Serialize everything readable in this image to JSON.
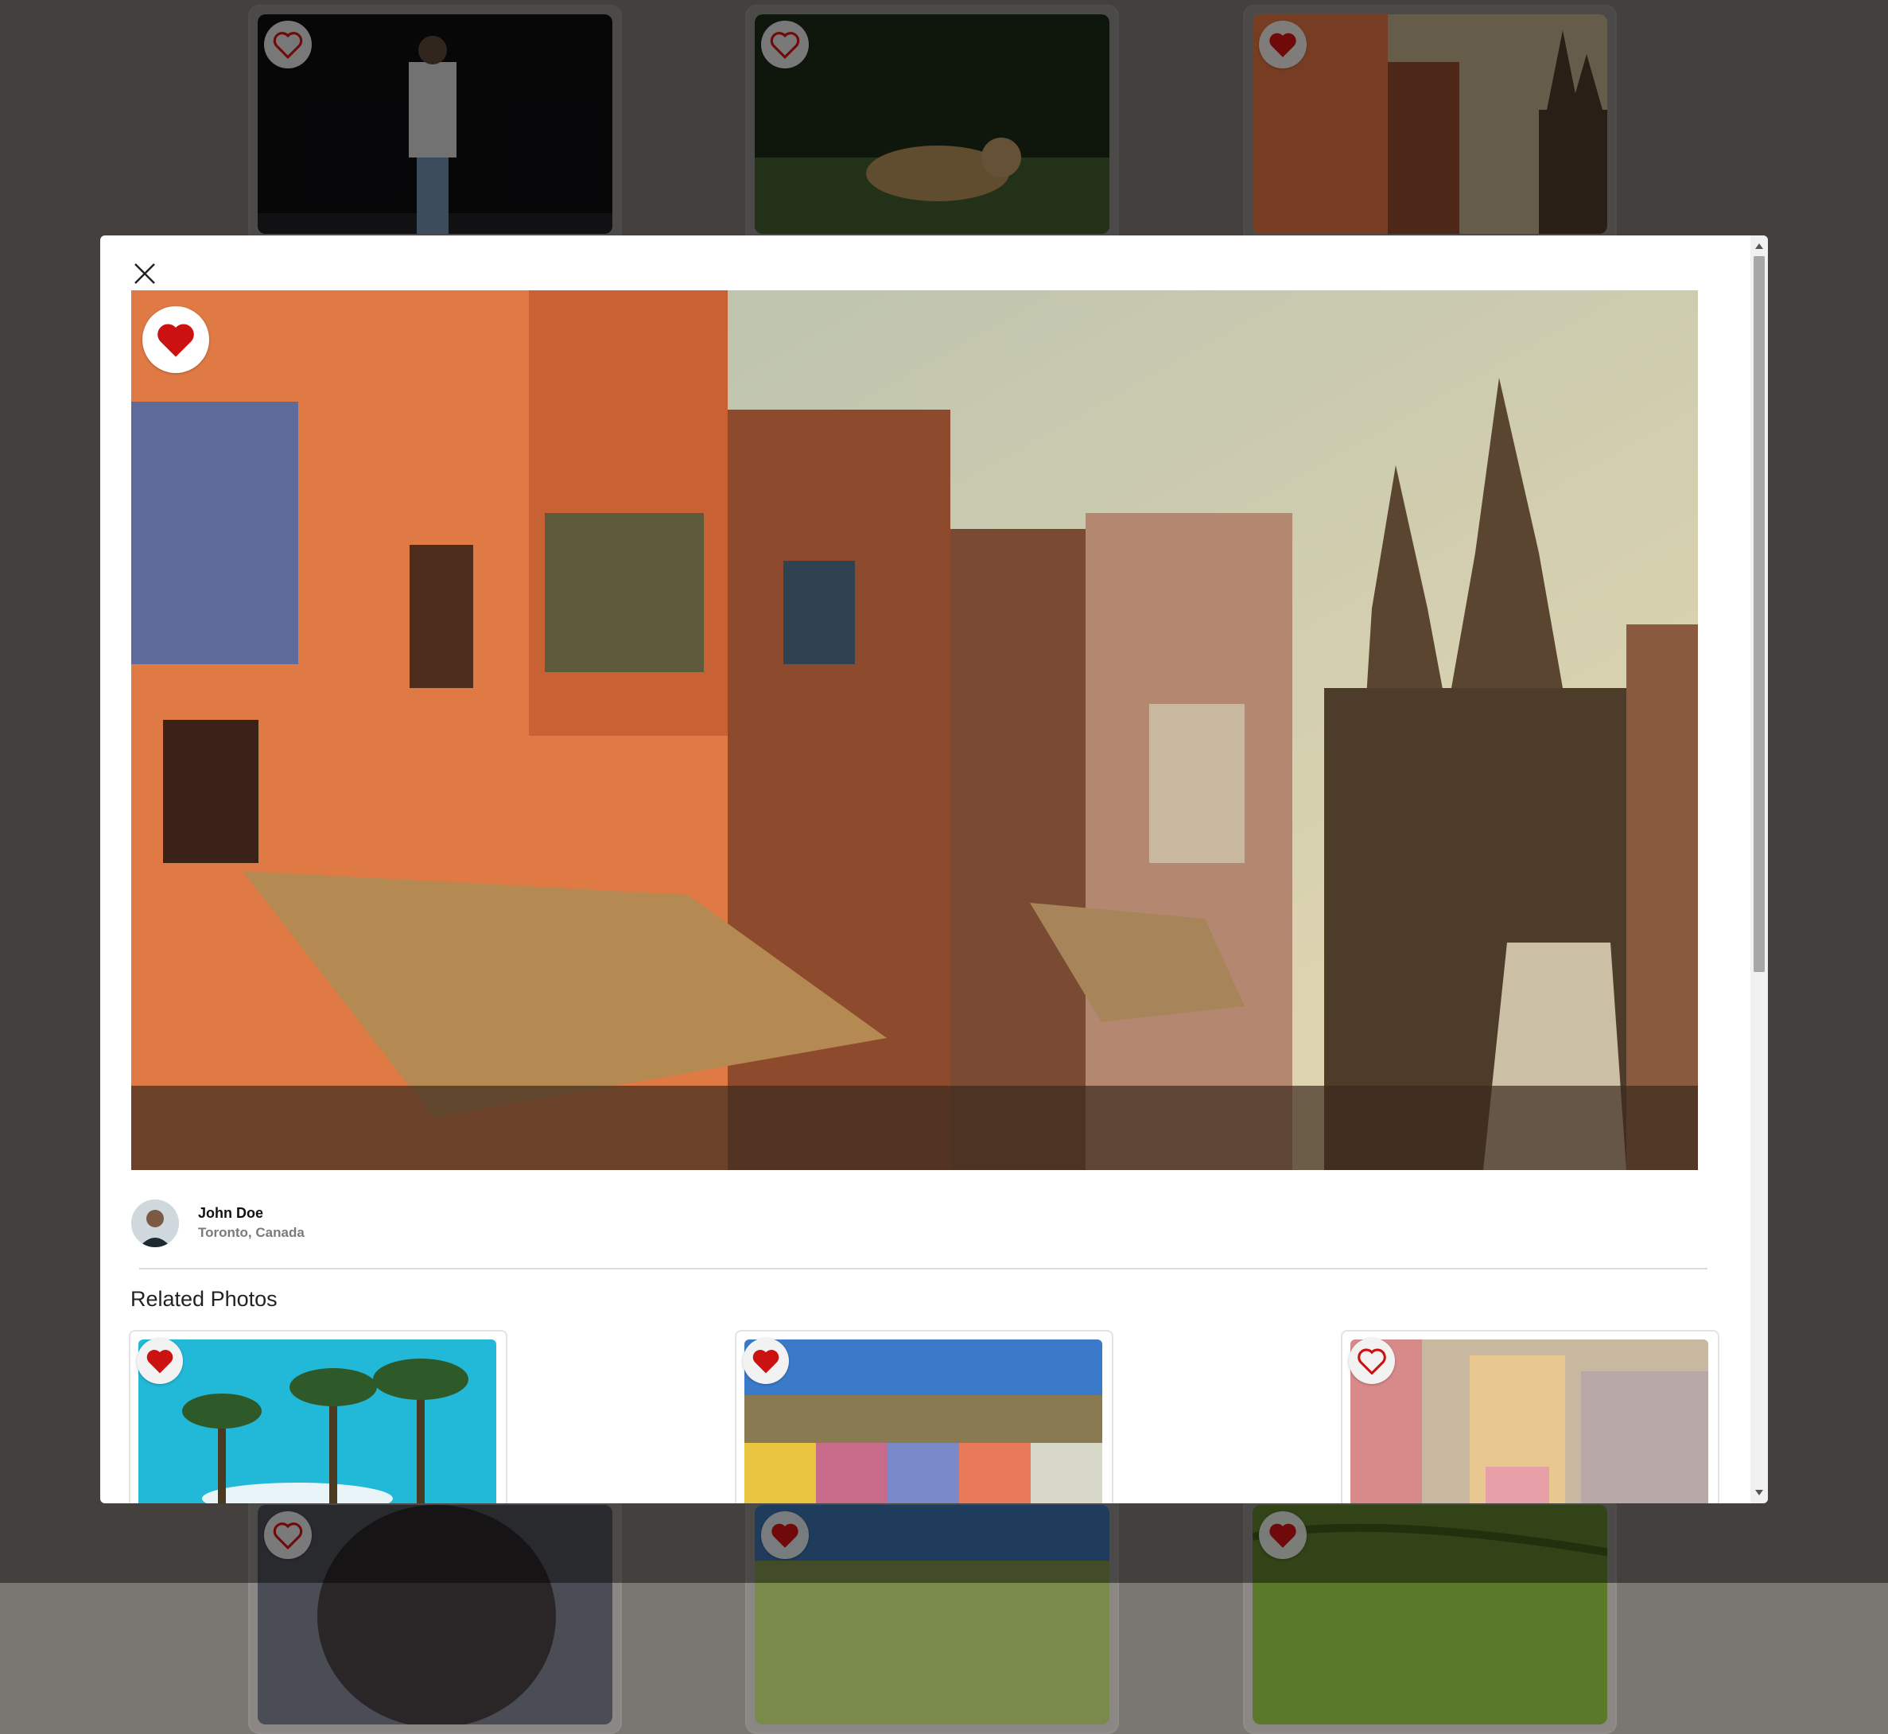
{
  "gallery": {
    "cards": [
      {
        "photo": "man-night-street",
        "favorited": false
      },
      {
        "photo": "jaguar-jungle",
        "favorited": false
      },
      {
        "photo": "varanasi-street",
        "favorited": true
      },
      {
        "photo": "dog-closeup",
        "favorited": false
      },
      {
        "photo": "hill-town",
        "favorited": true
      },
      {
        "photo": "rice-terraces",
        "favorited": true
      }
    ]
  },
  "modal": {
    "hero": {
      "photo": "varanasi-street",
      "favorited": true
    },
    "author": {
      "name": "John Doe",
      "location": "Toronto, Canada"
    },
    "related_title": "Related Photos",
    "related": [
      {
        "photo": "palm-trees-sky",
        "favorited": true
      },
      {
        "photo": "procida-colorful-town",
        "favorited": true
      },
      {
        "photo": "procida-houses",
        "favorited": false
      }
    ]
  },
  "colors": {
    "heart": "#cc1111",
    "heart_outline": "#cc1111",
    "overlay": "#7a7672"
  }
}
